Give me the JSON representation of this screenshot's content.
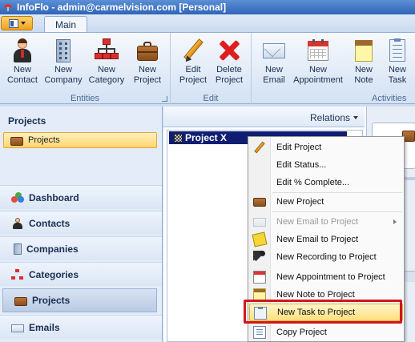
{
  "window": {
    "title": "InfoFlo - admin@carmelvision.com [Personal]"
  },
  "ribbon": {
    "tab_main": "Main",
    "groups": {
      "entities": {
        "title": "Entities",
        "buttons": [
          "New\nContact",
          "New\nCompany",
          "New\nCategory",
          "New\nProject"
        ]
      },
      "edit": {
        "title": "Edit",
        "buttons": [
          "Edit\nProject",
          "Delete\nProject"
        ]
      },
      "activities": {
        "title": "Activities",
        "buttons": [
          "New\nEmail",
          "New\nAppointment",
          "New\nNote",
          "New\nTask"
        ]
      }
    }
  },
  "nav": {
    "header": "Projects",
    "selected_item": "Projects",
    "buttons": [
      "Dashboard",
      "Contacts",
      "Companies",
      "Categories",
      "Projects",
      "Emails"
    ],
    "active": "Projects"
  },
  "main": {
    "relations_label": "Relations",
    "project_row": "Project X"
  },
  "context_menu": {
    "items": [
      {
        "label": "Edit Project",
        "icon": "pencil-icon",
        "enabled": true
      },
      {
        "label": "Edit Status...",
        "icon": "",
        "enabled": true
      },
      {
        "label": "Edit % Complete...",
        "icon": "",
        "enabled": true
      },
      {
        "label": "New Project",
        "icon": "briefcase-icon",
        "enabled": true
      },
      {
        "label": "New Email to Project",
        "icon": "envelope-icon",
        "enabled": false,
        "submenu": true
      },
      {
        "label": "New Email to Project",
        "icon": "sticky-note-icon",
        "enabled": true
      },
      {
        "label": "New Recording to Project",
        "icon": "microphone-icon",
        "enabled": true
      },
      {
        "label": "New Appointment to Project",
        "icon": "calendar-icon",
        "enabled": true
      },
      {
        "label": "New Note to Project",
        "icon": "note-pad-icon",
        "enabled": true
      },
      {
        "label": "New Task to Project",
        "icon": "task-clipboard-icon",
        "enabled": true,
        "highlighted": true
      },
      {
        "label": "Copy Project",
        "icon": "copy-icon",
        "enabled": true
      }
    ]
  },
  "colors": {
    "title_bar": "#2f65b6",
    "selection_navy": "#101e72",
    "highlight_yellow": "#ffdf7b",
    "annotation_red": "#d0171c"
  }
}
